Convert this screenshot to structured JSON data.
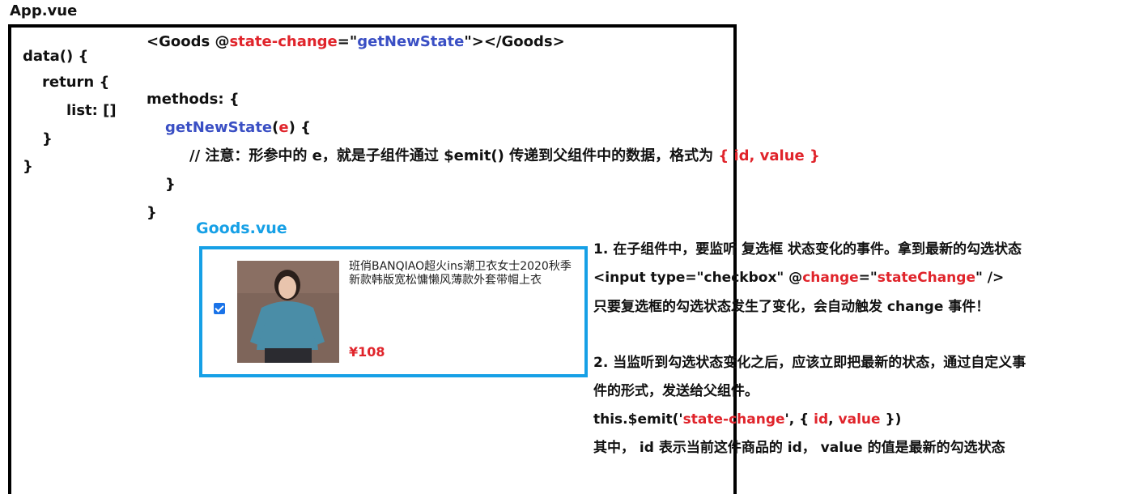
{
  "app_label": "App.vue",
  "app_code": {
    "data_lines": [
      "data() {",
      "return {",
      "list: []",
      "}",
      "}"
    ],
    "tag_open": "<Goods @",
    "tag_event": "state-change",
    "tag_eq": "=\"",
    "tag_handler": "getNewState",
    "tag_close": "\"></Goods>",
    "methods": "methods: {",
    "fn_name": "getNewState",
    "fn_paren_open": "(",
    "fn_param": "e",
    "fn_paren_close": ") {",
    "comment": "// 注意：形参中的 e，就是子组件通过 $emit() 传递到父组件中的数据，格式为 ",
    "comment_format": "{ id, value }",
    "close_inner": "}",
    "close_outer": "}"
  },
  "goods_label": "Goods.vue",
  "product": {
    "checked": true,
    "name": "班俏BANQIAO超火ins潮卫衣女士2020秋季新款韩版宽松慵懒风薄款外套带帽上衣",
    "price": "¥108"
  },
  "notes": {
    "n1": "1. 在子组件中，要监听 复选框 状态变化的事件。拿到最新的勾选状态",
    "n2_a": "<input type=\"checkbox\" @",
    "n2_event": "change",
    "n2_b": "=\"",
    "n2_handler": "stateChange",
    "n2_c": "\" />",
    "n3": "只要复选框的勾选状态发生了变化，会自动触发 change 事件！",
    "n4": "2. 当监听到勾选状态变化之后，应该立即把最新的状态，通过自定义事",
    "n5": "件的形式，发送给父组件。",
    "n6_a": "this.$emit('",
    "n6_event": "state-change",
    "n6_b": "', { ",
    "n6_id": "id",
    "n6_comma": ", ",
    "n6_value": "value",
    "n6_c": " })",
    "n7": "其中， id 表示当前这件商品的 id， value 的值是最新的勾选状态"
  },
  "colors": {
    "keyword_red": "#e0242b",
    "handler_blue": "#3a4fc4",
    "goods_border": "#16a0e6"
  }
}
